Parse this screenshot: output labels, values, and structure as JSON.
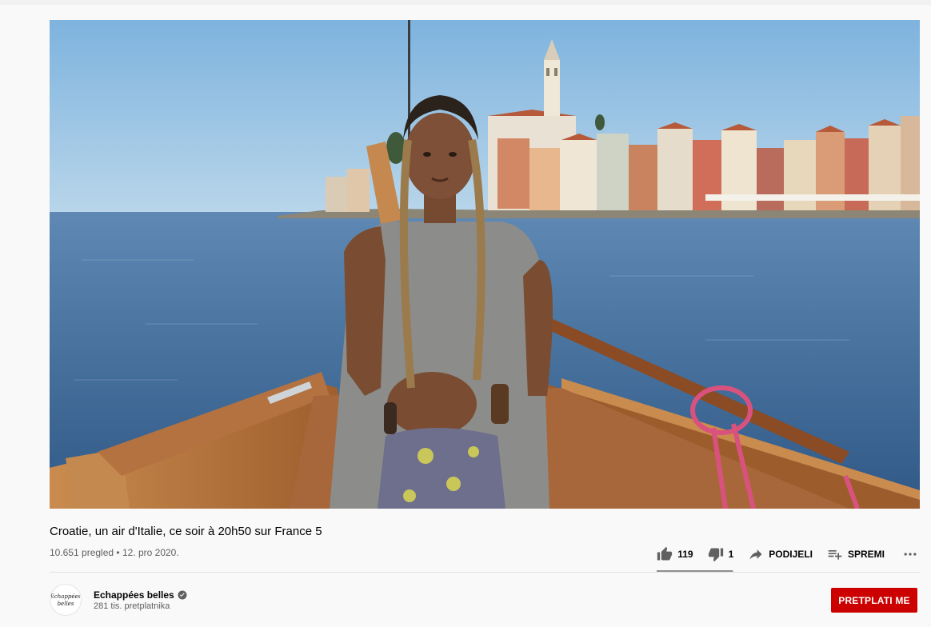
{
  "video": {
    "title": "Croatie, un air d'Italie, ce soir à 20h50 sur France 5",
    "views": "10.651 pregled",
    "separator": "•",
    "date": "12. pro 2020."
  },
  "actions": {
    "like_count": "119",
    "dislike_count": "1",
    "share_label": "PODIJELI",
    "save_label": "SPREMI",
    "like_ratio": 0.99
  },
  "channel": {
    "name": "Echappées belles",
    "subscribers": "281 tis. pretplatnika",
    "avatar_text": "Echappées belles"
  },
  "subscribe": {
    "label": "PRETPLATI ME",
    "color": "#cc0000"
  },
  "icons": {
    "like": "thumbs-up-icon",
    "dislike": "thumbs-down-icon",
    "share": "share-arrow-icon",
    "save": "playlist-add-icon",
    "more": "more-horizontal-icon",
    "verified": "verified-check-icon"
  }
}
